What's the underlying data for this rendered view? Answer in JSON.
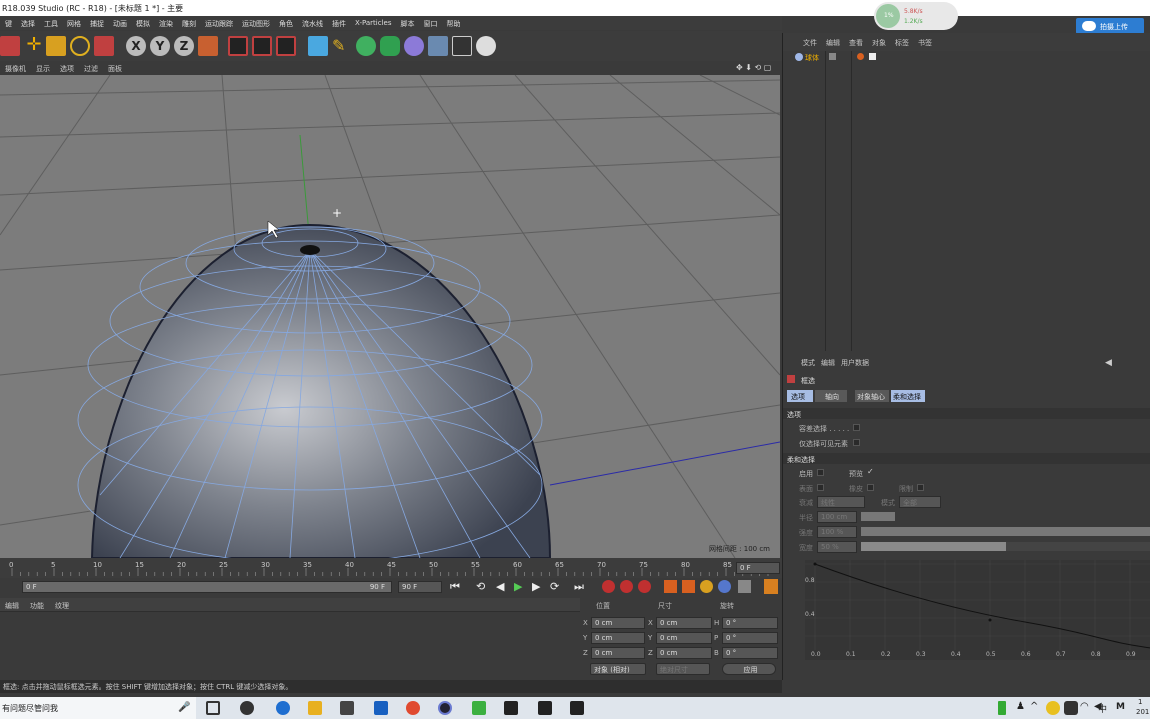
{
  "window": {
    "title": "R18.039 Studio (RC - R18) - [未标题 1 *] - 主要"
  },
  "network": {
    "up": "5.8K/s",
    "down": "1.2K/s",
    "percent": "1%"
  },
  "upload_button": {
    "label": "拍摄上传"
  },
  "menubar": [
    "键",
    "选择",
    "工具",
    "网格",
    "捕捉",
    "动画",
    "模拟",
    "渲染",
    "雕刻",
    "运动跟踪",
    "运动图形",
    "角色",
    "流水线",
    "插件",
    "X-Particles",
    "脚本",
    "窗口",
    "帮助"
  ],
  "toolbar": {
    "x_label": "X",
    "y_label": "Y",
    "z_label": "Z"
  },
  "viewport_menu": [
    "摄像机",
    "显示",
    "选项",
    "过滤",
    "面板"
  ],
  "viewport": {
    "grid_spacing": "网格间距 : 100 cm"
  },
  "timeline": {
    "ticks": [
      "0",
      "5",
      "10",
      "15",
      "20",
      "25",
      "30",
      "35",
      "40",
      "45",
      "50",
      "55",
      "60",
      "65",
      "70",
      "75",
      "80",
      "85",
      "90"
    ],
    "current_frame": "0 F"
  },
  "playbar": {
    "start": "0 F",
    "end_slider": "90 F",
    "end": "90 F"
  },
  "material_panel": {
    "tabs": [
      "编辑",
      "功能",
      "纹理"
    ]
  },
  "coords": {
    "headers": [
      "位置",
      "尺寸",
      "旋转"
    ],
    "rows": [
      {
        "a": "X",
        "av": "0 cm",
        "b": "X",
        "bv": "0 cm",
        "c": "H",
        "cv": "0 °"
      },
      {
        "a": "Y",
        "av": "0 cm",
        "b": "Y",
        "bv": "0 cm",
        "c": "P",
        "cv": "0 °"
      },
      {
        "a": "Z",
        "av": "0 cm",
        "b": "Z",
        "bv": "0 cm",
        "c": "B",
        "cv": "0 °"
      }
    ],
    "mode": "对象 (相对)",
    "size_mode": "绝对尺寸",
    "apply": "应用"
  },
  "statusbar": "框选: 点击并拖动鼠标框选元素。按住 SHIFT 键增加选择对象；按住 CTRL 键减少选择对象。",
  "object_manager": {
    "menu": [
      "文件",
      "编辑",
      "查看",
      "对象",
      "标签",
      "书签"
    ],
    "object_name": "球体"
  },
  "attribute_manager": {
    "menu": [
      "模式",
      "编辑",
      "用户数据"
    ],
    "tool_name": "框选",
    "tabs": [
      "选项",
      "轴向",
      "对象轴心",
      "柔和选择"
    ],
    "options_header": "选项",
    "tolerant": "容差选择 . . . . .",
    "visible_only": "仅选择可见元素",
    "soft_header": "柔和选择",
    "enable": "启用",
    "preview": "预览",
    "surface": "表面",
    "rubber": "橡皮",
    "restrict": "限制",
    "falloff_label": "衰减",
    "falloff_value": "线性",
    "mode_label": "模式",
    "mode_value": "全部",
    "radius_label": "半径",
    "radius_value": "100 cm",
    "strength_label": "强度",
    "strength_value": "100 %",
    "width_label": "宽度",
    "width_value": "50 %",
    "width_fraction": 0.5,
    "graph_y": [
      "0.8",
      "0.4"
    ],
    "graph_x": [
      "0.0",
      "0.1",
      "0.2",
      "0.3",
      "0.4",
      "0.5",
      "0.6",
      "0.7",
      "0.8",
      "0.9"
    ]
  },
  "taskbar": {
    "search": "有问题尽管问我",
    "ime": "中",
    "ime2": "M",
    "clock": "1",
    "clock2": "201"
  }
}
